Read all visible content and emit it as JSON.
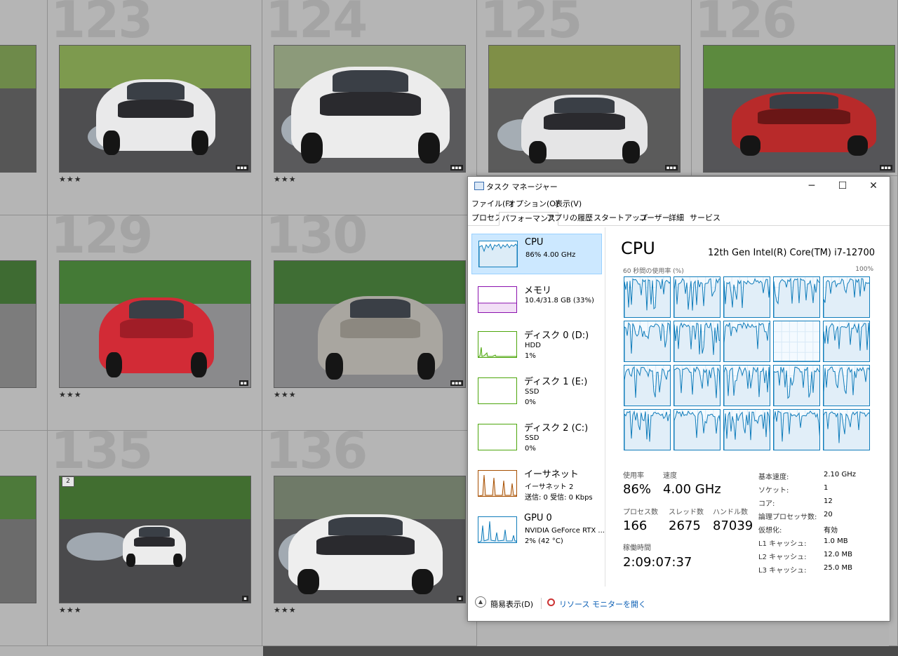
{
  "grid": {
    "cells": [
      {
        "num": "123",
        "stars": "★★★",
        "col": 0,
        "row": 0
      },
      {
        "num": "124",
        "stars": "★★★",
        "col": 1,
        "row": 0
      },
      {
        "num": "125",
        "stars": "★★★",
        "col": 2,
        "row": 0
      },
      {
        "num": "126",
        "stars": "",
        "col": 3,
        "row": 0
      },
      {
        "num": "129",
        "stars": "★★★",
        "col": 0,
        "row": 1
      },
      {
        "num": "130",
        "stars": "★★★",
        "col": 1,
        "row": 1
      },
      {
        "num": "135",
        "stars": "★★★",
        "col": 0,
        "row": 2
      },
      {
        "num": "136",
        "stars": "★★★",
        "col": 1,
        "row": 2
      }
    ],
    "flag_135": "2"
  },
  "taskmanager": {
    "title": "タスク マネージャー",
    "window_buttons": {
      "minimize": "─",
      "maximize": "☐",
      "close": "✕"
    },
    "menu": [
      "ファイル(F)",
      "オプション(O)",
      "表示(V)"
    ],
    "tabs": [
      "プロセス",
      "パフォーマンス",
      "アプリの履歴",
      "スタートアップ",
      "ユーザー",
      "詳細",
      "サービス"
    ],
    "active_tab": "パフォーマンス",
    "resources": [
      {
        "name": "CPU",
        "line1": "86%  4.00 GHz",
        "line2": "",
        "color": "#117dbb",
        "active": true
      },
      {
        "name": "メモリ",
        "line1": "10.4/31.8 GB (33%)",
        "line2": "",
        "color": "#8b12ae",
        "active": false
      },
      {
        "name": "ディスク 0 (D:)",
        "line1": "HDD",
        "line2": "1%",
        "color": "#4da60c",
        "active": false
      },
      {
        "name": "ディスク 1 (E:)",
        "line1": "SSD",
        "line2": "0%",
        "color": "#4da60c",
        "active": false
      },
      {
        "name": "ディスク 2 (C:)",
        "line1": "SSD",
        "line2": "0%",
        "color": "#4da60c",
        "active": false
      },
      {
        "name": "イーサネット",
        "line1": "イーサネット 2",
        "line2": "送信: 0  受信: 0 Kbps",
        "color": "#a74f01",
        "active": false
      },
      {
        "name": "GPU 0",
        "line1": "NVIDIA GeForce RTX ...",
        "line2": "2%  (42 °C)",
        "color": "#117dbb",
        "active": false
      }
    ],
    "cpu": {
      "title": "CPU",
      "model": "12th Gen Intel(R) Core(TM) i7-12700",
      "chart_label": "60 秒間の使用率 (%)",
      "chart_max": "100%",
      "stats": [
        {
          "label": "使用率",
          "value": "86%"
        },
        {
          "label": "速度",
          "value": "4.00 GHz"
        },
        {
          "label": "プロセス数",
          "value": "166"
        },
        {
          "label": "スレッド数",
          "value": "2675"
        },
        {
          "label": "ハンドル数",
          "value": "87039"
        },
        {
          "label": "稼働時間",
          "value": "2:09:07:37"
        }
      ],
      "specs": [
        {
          "k": "基本速度:",
          "v": "2.10 GHz"
        },
        {
          "k": "ソケット:",
          "v": "1"
        },
        {
          "k": "コア:",
          "v": "12"
        },
        {
          "k": "論理プロセッサ数:",
          "v": "20"
        },
        {
          "k": "仮想化:",
          "v": "有効"
        },
        {
          "k": "L1 キャッシュ:",
          "v": "1.0 MB"
        },
        {
          "k": "L2 キャッシュ:",
          "v": "12.0 MB"
        },
        {
          "k": "L3 キャッシュ:",
          "v": "25.0 MB"
        }
      ]
    },
    "footer": {
      "fewer": "簡易表示(D)",
      "resource_monitor": "リソース モニターを開く"
    }
  }
}
